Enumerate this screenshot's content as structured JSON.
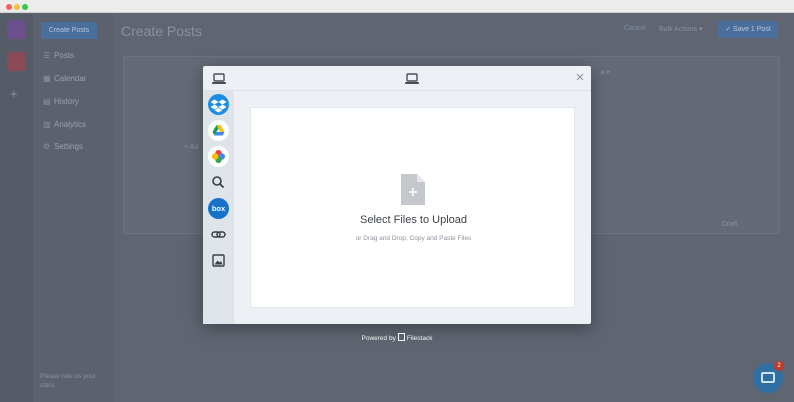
{
  "window": {
    "traffic_lights": [
      "#fc605c",
      "#fdbc40",
      "#34c84a"
    ]
  },
  "rail": {
    "add_label": "+"
  },
  "sidebar": {
    "create_button": "Create Posts",
    "items": [
      {
        "label": "Posts",
        "icon": "list-icon"
      },
      {
        "label": "Calendar",
        "icon": "calendar-icon"
      },
      {
        "label": "History",
        "icon": "history-icon"
      },
      {
        "label": "Analytics",
        "icon": "analytics-icon"
      },
      {
        "label": "Settings",
        "icon": "gear-icon"
      }
    ],
    "footer_text": "Please rate us your stars"
  },
  "main": {
    "title": "Create Posts",
    "cancel_label": "Cancel",
    "bulk_actions_label": "Bulk Actions ▾",
    "save_label": "✓ Save 1 Post",
    "add_label": "+ Ad",
    "card_controls": "…al ▾",
    "card_footer": "Draft"
  },
  "chat": {
    "badge": "2"
  },
  "modal": {
    "header_icon": "laptop-icon",
    "close_label": "×",
    "sources": [
      {
        "name": "my-device",
        "icon": "laptop-icon"
      },
      {
        "name": "dropbox",
        "icon": "dropbox-icon"
      },
      {
        "name": "google-drive",
        "icon": "google-drive-icon"
      },
      {
        "name": "google-photos",
        "icon": "google-photos-icon"
      },
      {
        "name": "web-search",
        "icon": "search-icon"
      },
      {
        "name": "box",
        "icon": "box-icon",
        "label": "box"
      },
      {
        "name": "link",
        "icon": "link-icon"
      },
      {
        "name": "image-search",
        "icon": "image-icon"
      }
    ],
    "drop_title": "Select Files to Upload",
    "drop_subtitle": "or Drag and Drop, Copy and Paste Files",
    "powered_prefix": "Powered by",
    "powered_brand": "Filestack",
    "accent": "#1c8de6"
  }
}
